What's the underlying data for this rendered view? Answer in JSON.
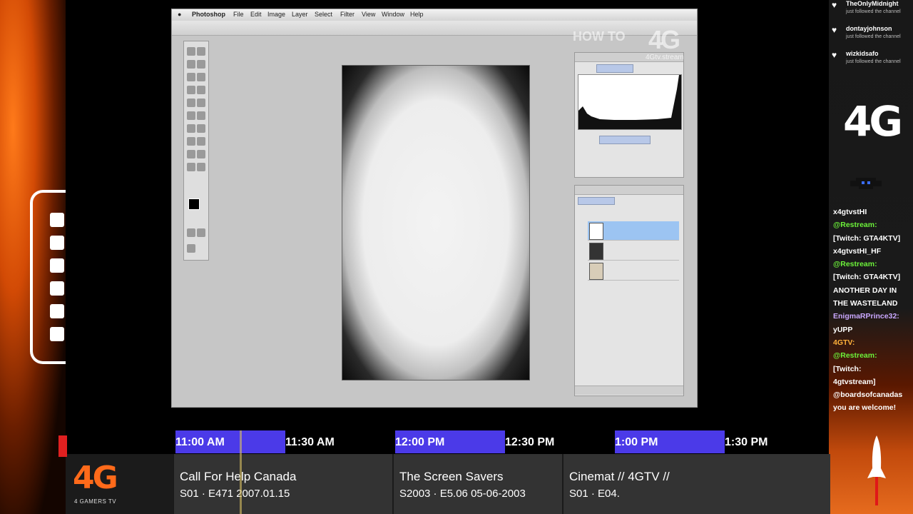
{
  "followers": [
    {
      "name": "TheOnlyMidnight",
      "subtitle": "just followed the channel"
    },
    {
      "name": "dontayjohnson",
      "subtitle": "just followed the channel"
    },
    {
      "name": "wizkidsafo",
      "subtitle": "just followed the channel"
    }
  ],
  "brand": {
    "logo": "4G",
    "sub": "4 GAMERS TV"
  },
  "watermark": {
    "how_to": "HOW TO",
    "logo": "4G",
    "url": "4Gtv.stream"
  },
  "photoshop": {
    "app_name": "Photoshop",
    "menus": [
      "File",
      "Edit",
      "Image",
      "Layer",
      "Select",
      "Filter",
      "View",
      "Window",
      "Help"
    ]
  },
  "chat": [
    {
      "text": "x4gtvstHI",
      "color": "w"
    },
    {
      "text": "@Restream:",
      "color": "g"
    },
    {
      "text": "[Twitch: GTA4KTV]",
      "color": "w"
    },
    {
      "text": "x4gtvstHI_HF",
      "color": "w"
    },
    {
      "text": "@Restream:",
      "color": "g"
    },
    {
      "text": "[Twitch: GTA4KTV]",
      "color": "w"
    },
    {
      "text": "ANOTHER DAY IN",
      "color": "w"
    },
    {
      "text": "THE WASTELAND",
      "color": "w"
    },
    {
      "text": "EnigmaRPrince32:",
      "color": "p"
    },
    {
      "text": "yUPP",
      "color": "w"
    },
    {
      "text": "4GTV:",
      "color": "o"
    },
    {
      "text": "@Restream:",
      "color": "g"
    },
    {
      "text": "[Twitch:",
      "color": "w"
    },
    {
      "text": "4gtvstream]",
      "color": "w"
    },
    {
      "text": "@boardsofcanadas",
      "color": "w"
    },
    {
      "text": "you are welcome!",
      "color": "w"
    }
  ],
  "timeline": [
    "11:00 AM",
    "11:30 AM",
    "12:00 PM",
    "12:30 PM",
    "1:00 PM",
    "1:30 PM"
  ],
  "schedule": [
    {
      "title": "Call For Help Canada",
      "episode": "S01 · E471 2007.01.15"
    },
    {
      "title": "The Screen Savers",
      "episode": "S2003 · E5.06 05-06-2003"
    },
    {
      "title": "Cinemat // 4GTV //",
      "episode": "S01 · E04."
    }
  ],
  "colors": {
    "timeline_block": "#4b3ae8",
    "brand_orange": "#ff6a1a",
    "chat_green": "#6cf23a"
  }
}
